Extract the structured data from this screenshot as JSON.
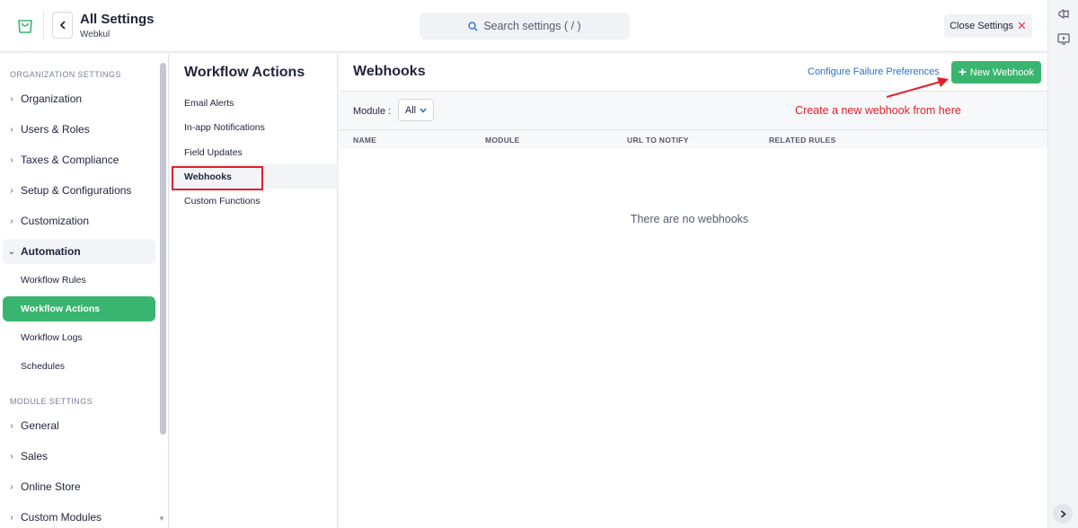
{
  "header": {
    "title": "All Settings",
    "subtitle": "Webkul",
    "search_placeholder": "Search settings ( / )",
    "close_label": "Close Settings",
    "close_symbol": "✕"
  },
  "sidebar": {
    "org_section": "ORGANIZATION SETTINGS",
    "module_section": "MODULE SETTINGS",
    "org_items": [
      {
        "label": "Organization"
      },
      {
        "label": "Users & Roles"
      },
      {
        "label": "Taxes & Compliance"
      },
      {
        "label": "Setup & Configurations"
      },
      {
        "label": "Customization"
      },
      {
        "label": "Automation"
      }
    ],
    "automation_sub": [
      {
        "label": "Workflow Rules"
      },
      {
        "label": "Workflow Actions"
      },
      {
        "label": "Workflow Logs"
      },
      {
        "label": "Schedules"
      }
    ],
    "module_items": [
      {
        "label": "General"
      },
      {
        "label": "Sales"
      },
      {
        "label": "Online Store"
      },
      {
        "label": "Custom Modules"
      }
    ]
  },
  "workflow_actions": {
    "title": "Workflow Actions",
    "items": [
      {
        "label": "Email Alerts"
      },
      {
        "label": "In-app Notifications"
      },
      {
        "label": "Field Updates"
      },
      {
        "label": "Webhooks"
      },
      {
        "label": "Custom Functions"
      }
    ]
  },
  "main": {
    "title": "Webhooks",
    "failure_link": "Configure Failure Preferences",
    "new_button": "New Webhook",
    "module_label": "Module :",
    "module_value": "All",
    "columns": [
      "NAME",
      "MODULE",
      "URL TO NOTIFY",
      "RELATED RULES"
    ],
    "empty_message": "There are no webhooks",
    "annotation": "Create a new webhook from here"
  },
  "colors": {
    "accent_green": "#3ab56f",
    "link_blue": "#2a73c9",
    "annotation_red": "#e0202a"
  }
}
